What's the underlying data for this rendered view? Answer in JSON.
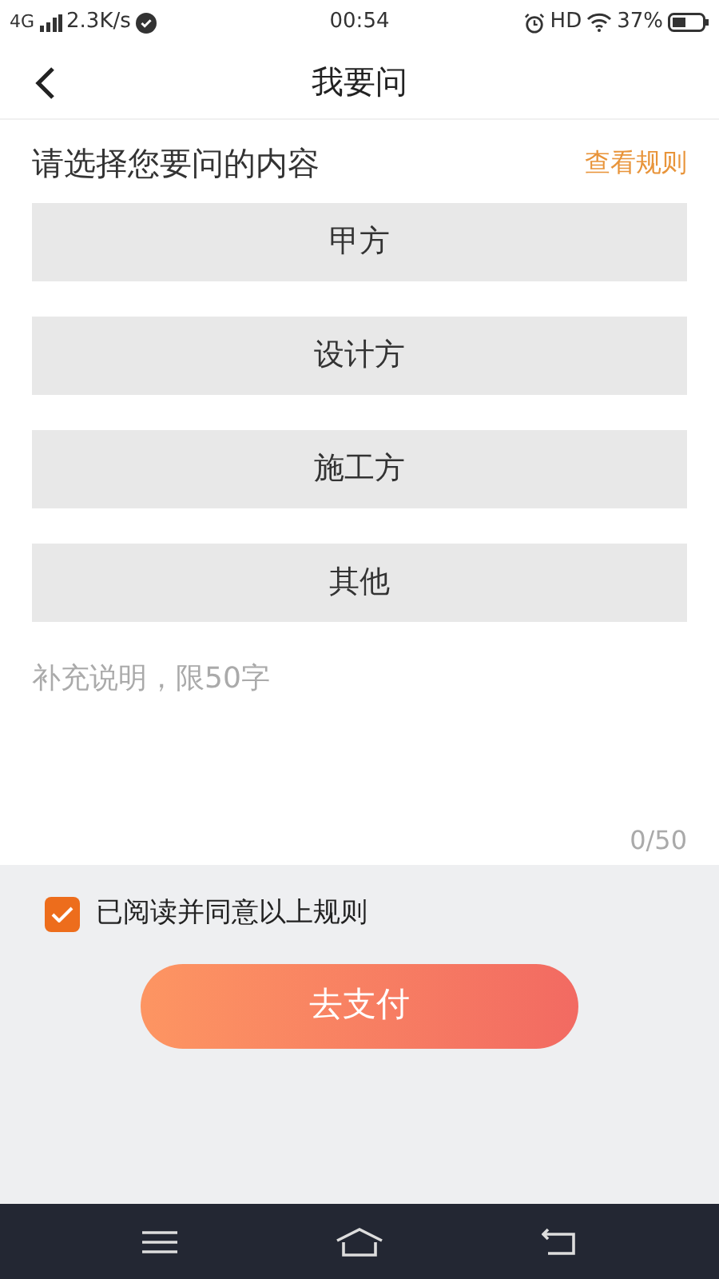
{
  "status_bar": {
    "network": "4G",
    "speed": "2.3K/s",
    "time": "00:54",
    "hd": "HD",
    "battery": "37%"
  },
  "header": {
    "title": "我要问"
  },
  "section": {
    "title": "请选择您要问的内容",
    "rules_link": "查看规则"
  },
  "options": [
    {
      "label": "甲方",
      "selected": false
    },
    {
      "label": "设计方",
      "selected": false
    },
    {
      "label": "施工方",
      "selected": false
    },
    {
      "label": "其他",
      "selected": false
    }
  ],
  "note": {
    "placeholder": "补充说明，限50字",
    "counter": "0/50"
  },
  "agreement": {
    "label": "已阅读并同意以上规则",
    "checked": true
  },
  "pay_button": "去支付"
}
